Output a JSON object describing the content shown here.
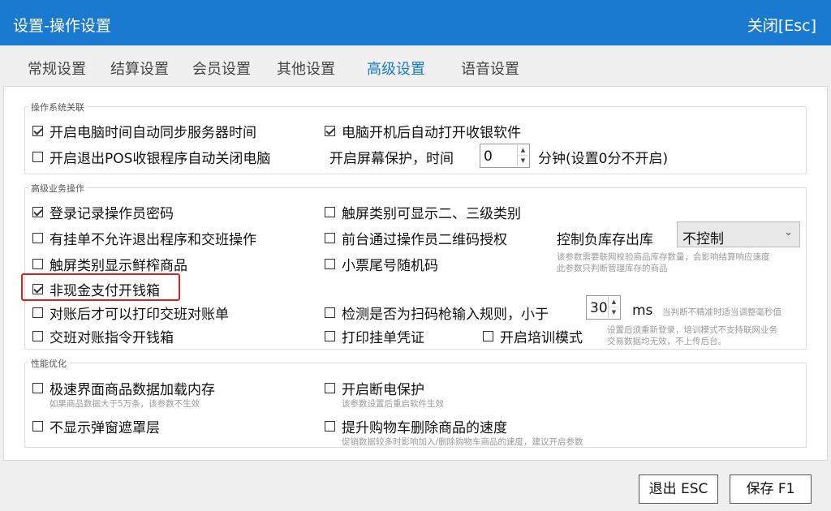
{
  "window": {
    "title": "设置-操作设置",
    "close_label": "关闭[Esc]"
  },
  "tabs": [
    {
      "label": "常规设置",
      "active": false
    },
    {
      "label": "结算设置",
      "active": false
    },
    {
      "label": "会员设置",
      "active": false
    },
    {
      "label": "其他设置",
      "active": false
    },
    {
      "label": "高级设置",
      "active": true
    },
    {
      "label": "语音设置",
      "active": false
    }
  ],
  "os_group": {
    "label": "操作系统关联",
    "sync_time": {
      "label": "开启电脑时间自动同步服务器时间",
      "checked": true
    },
    "autostart": {
      "label": "电脑开机后自动打开收银软件",
      "checked": true
    },
    "shutdown_on_exit": {
      "label": "开启退出POS收银程序自动关闭电脑",
      "checked": false
    },
    "screensaver": {
      "prefix": "开启屏幕保护，时间",
      "value": "0",
      "suffix": "分钟(设置0分不开启)"
    }
  },
  "business_group": {
    "label": "高级业务操作",
    "record_password": {
      "label": "登录记录操作员密码",
      "checked": true
    },
    "touch_sub_category": {
      "label": "触屏类别可显示二、三级类别",
      "checked": false
    },
    "no_exit_with_pending": {
      "label": "有挂单不允许退出程序和交班操作",
      "checked": false
    },
    "qr_auth": {
      "label": "前台通过操作员二维码授权",
      "checked": false
    },
    "negative_stock": {
      "label": "控制负库存出库",
      "selected": "不控制",
      "hint_line1": "该参数需要联网校验商品库存数量，会影响结算响应速度",
      "hint_line2": "此参数只判断管理库存的商品"
    },
    "touch_fresh": {
      "label": "触屏类别显示鲜榨商品",
      "checked": false
    },
    "random_receipt_tail": {
      "label": "小票尾号随机码",
      "checked": false
    },
    "non_cash_drawer": {
      "label": "非现金支付开钱箱",
      "checked": true
    },
    "print_after_reconcile": {
      "label": "对账后才可以打印交班对账单",
      "checked": false
    },
    "scan_rule": {
      "label": "检测是否为扫码枪输入规则，小于",
      "checked": false,
      "value": "30",
      "unit": "ms",
      "hint": "当判断不精准时适当调整毫秒值"
    },
    "shift_drawer": {
      "label": "交班对账指令开钱箱",
      "checked": false
    },
    "print_pending": {
      "label": "打印挂单凭证",
      "checked": false
    },
    "training_mode": {
      "label": "开启培训模式",
      "checked": false,
      "hint_line1": "设置后须重新登录，培训模式不支持联网业务",
      "hint_line2": "交易数据均无效，不上传后台。"
    }
  },
  "perf_group": {
    "label": "性能优化",
    "memory_load": {
      "label": "极速界面商品数据加载内存",
      "checked": false,
      "hint": "如果商品数据大于5万条，该参数不生效"
    },
    "power_protect": {
      "label": "开启断电保护",
      "checked": false,
      "hint": "该参数设置后重启软件生效"
    },
    "no_mask": {
      "label": "不显示弹窗遮罩层",
      "checked": false
    },
    "cart_speed": {
      "label": "提升购物车删除商品的速度",
      "checked": false,
      "hint": "促销数据较多时影响加入/删除购物车商品的速度，建议开启参数"
    }
  },
  "footer": {
    "exit_label": "退出 ESC",
    "save_label": "保存 F1"
  }
}
